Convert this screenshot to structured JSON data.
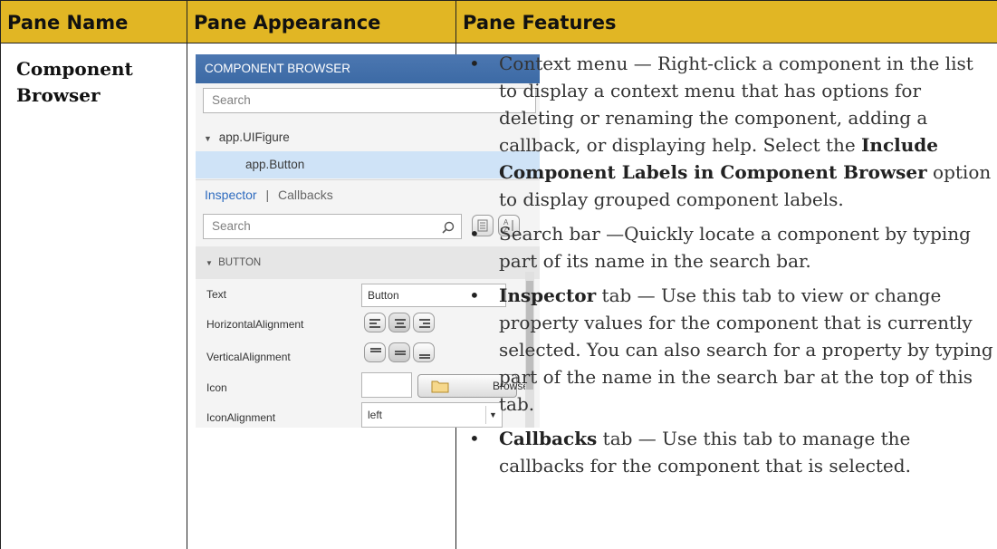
{
  "headers": {
    "pane_name": "Pane Name",
    "pane_appearance": "Pane Appearance",
    "pane_features": "Pane Features"
  },
  "row": {
    "pane_name_line1": "Component",
    "pane_name_line2": "Browser"
  },
  "pane": {
    "title": "COMPONENT BROWSER",
    "search_placeholder": "Search",
    "tree": {
      "root": "app.UIFigure",
      "child": "app.Button"
    },
    "tabs": {
      "inspector": "Inspector",
      "separator": "|",
      "callbacks": "Callbacks"
    },
    "inspector_search_placeholder": "Search",
    "section": "BUTTON",
    "properties": {
      "text_label": "Text",
      "text_value": "Button",
      "horizontal_alignment_label": "HorizontalAlignment",
      "vertical_alignment_label": "VerticalAlignment",
      "icon_label": "Icon",
      "browse_button": "Browse",
      "icon_alignment_label": "IconAlignment",
      "icon_alignment_value": "left"
    }
  },
  "features": {
    "context_menu": {
      "text": "Context menu — Right-click a component in the list to display a context menu that has options for deleting or renaming the component, adding a callback, or displaying help. Select the ",
      "bold": "Include Component Labels in Component Browser",
      "after": " option to display grouped component labels."
    },
    "search_bar": {
      "text": "Search bar —Quickly locate a component by typing part of its name in the search bar."
    },
    "inspector_tab": {
      "bold": "Inspector",
      "text": " tab — Use this tab to view or change property values for the component that is currently selected. You can also search for a property by typing part of the name in the search bar at the top of this tab."
    },
    "callbacks_tab": {
      "bold": "Callbacks",
      "text": " tab — Use this tab to manage the callbacks for the component that is selected."
    }
  }
}
